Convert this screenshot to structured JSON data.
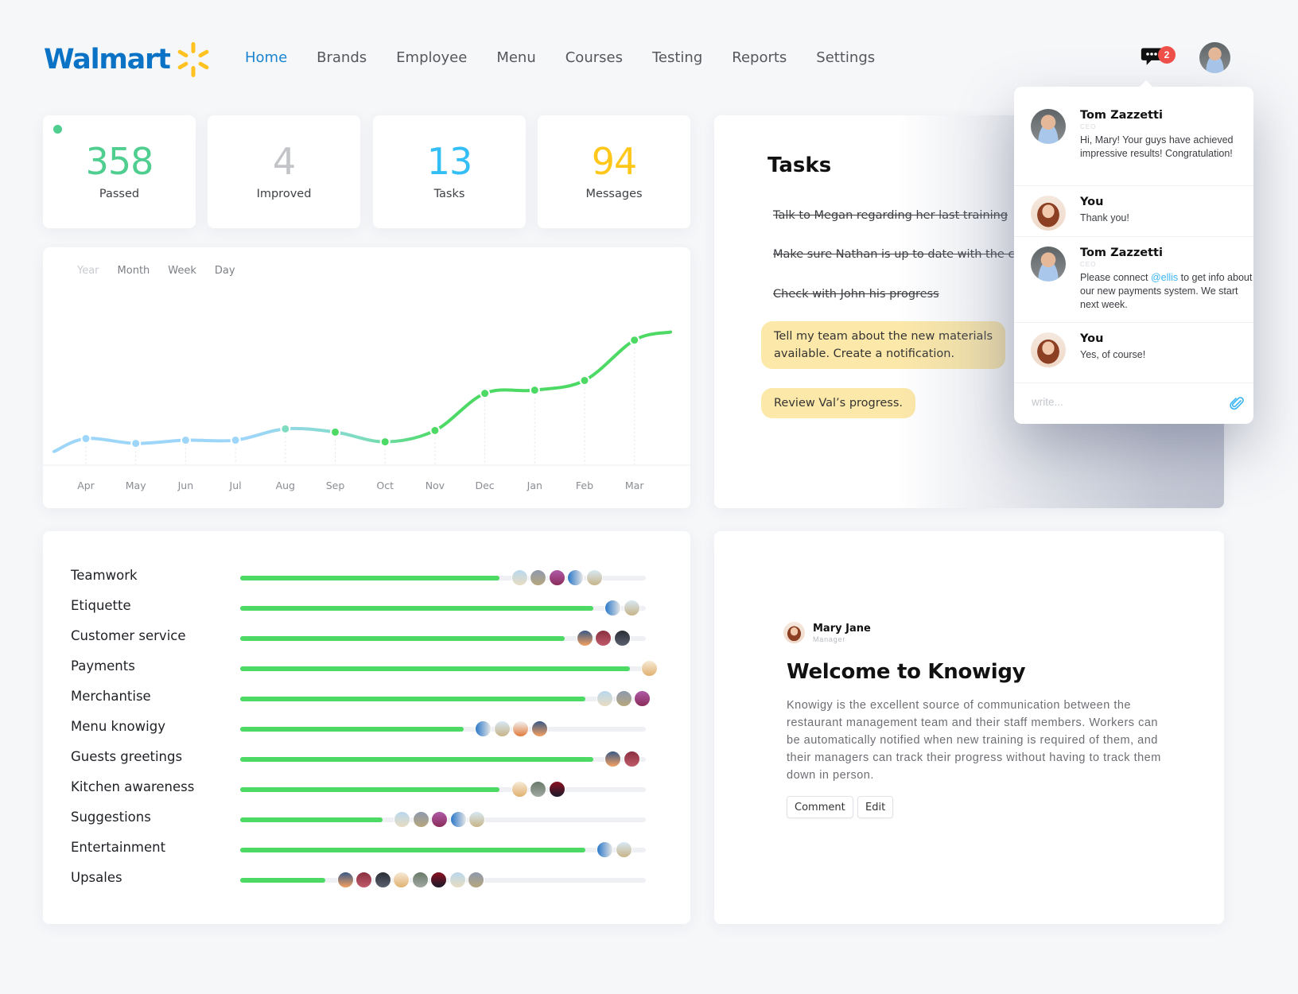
{
  "brand": {
    "name": "Walmart",
    "logo_color": "#0a73c6",
    "spark_color": "#ffc220"
  },
  "nav": {
    "items": [
      {
        "label": "Home",
        "active": true
      },
      {
        "label": "Brands",
        "active": false
      },
      {
        "label": "Employee",
        "active": false
      },
      {
        "label": "Menu",
        "active": false
      },
      {
        "label": "Courses",
        "active": false
      },
      {
        "label": "Testing",
        "active": false
      },
      {
        "label": "Reports",
        "active": false
      },
      {
        "label": "Settings",
        "active": false
      }
    ],
    "chat_icon": "chat-bubble-icon",
    "chat_badge": "2",
    "user_avatar": "avatar"
  },
  "stats": [
    {
      "value": "358",
      "label": "Passed",
      "color": "#4fce8f",
      "online_indicator": true
    },
    {
      "value": "4",
      "label": "Improved",
      "color": "#c3c4c7"
    },
    {
      "value": "13",
      "label": "Tasks",
      "color": "#33bff5"
    },
    {
      "value": "94",
      "label": "Messages",
      "color": "#ffc71a"
    }
  ],
  "chart": {
    "periods": [
      {
        "label": "Year",
        "active": false
      },
      {
        "label": "Month",
        "active": true
      },
      {
        "label": "Week",
        "active": true
      },
      {
        "label": "Day",
        "active": true
      }
    ]
  },
  "chart_data": {
    "type": "line",
    "title": "",
    "xlabel": "",
    "ylabel": "",
    "categories": [
      "Apr",
      "May",
      "Jun",
      "Jul",
      "Aug",
      "Sep",
      "Oct",
      "Nov",
      "Dec",
      "Jan",
      "Feb",
      "Mar"
    ],
    "values": [
      16,
      13,
      15,
      15,
      22,
      20,
      14,
      21,
      44,
      46,
      52,
      77
    ],
    "start_value": 8,
    "end_value": 82,
    "ylim": [
      0,
      100
    ],
    "grid": false,
    "colors": {
      "low": "#9dd6f9",
      "mid": "#7edcc0",
      "high": "#4cd964"
    }
  },
  "tasks": {
    "title": "Tasks",
    "done": [
      "Talk to Megan regarding her last training",
      "Make sure Nathan is up to date with the changes",
      "Check with John his progress"
    ],
    "pending": [
      "Tell my team about the new materials\navailable. Create a notification.",
      "Review Val’s progress."
    ],
    "pending_color": "#fce8a8"
  },
  "chat": {
    "messages": [
      {
        "name": "Tom Zazzetti",
        "role": "CEO",
        "text": "Hi, Mary! Your guys have achieved impressive results! Congratulation!",
        "avatar": "tom"
      },
      {
        "name": "You",
        "role": "",
        "text": "Thank you!",
        "avatar": "mary"
      },
      {
        "name": "Tom Zazzetti",
        "role": "CEO",
        "text_before": "Please connect ",
        "mention": "@ellis",
        "text_after": " to get info about our new payments system. We start next week.",
        "avatar": "tom"
      },
      {
        "name": "You",
        "role": "",
        "text": "Yes, of course!",
        "avatar": "mary"
      }
    ],
    "input_placeholder": "write...",
    "attach_icon": "paperclip-icon"
  },
  "skills": [
    {
      "label": "Teamwork",
      "progress": 0.64,
      "avatars": 5
    },
    {
      "label": "Etiquette",
      "progress": 0.87,
      "avatars": 2
    },
    {
      "label": "Customer service",
      "progress": 0.8,
      "avatars": 3
    },
    {
      "label": "Payments",
      "progress": 0.96,
      "avatars": 1
    },
    {
      "label": "Merchantise",
      "progress": 0.85,
      "avatars": 3
    },
    {
      "label": "Menu knowigy",
      "progress": 0.55,
      "avatars": 4
    },
    {
      "label": "Guests greetings",
      "progress": 0.87,
      "avatars": 2
    },
    {
      "label": "Kitchen awareness",
      "progress": 0.64,
      "avatars": 3
    },
    {
      "label": "Suggestions",
      "progress": 0.35,
      "avatars": 5
    },
    {
      "label": "Entertainment",
      "progress": 0.85,
      "avatars": 2
    },
    {
      "label": "Upsales",
      "progress": 0.21,
      "avatars": 8
    }
  ],
  "welcome": {
    "author_name": "Mary Jane",
    "author_role": "Manager",
    "title": "Welcome to Knowigy",
    "body": "Knowigy is the excellent source of communication between the restaurant management team and their staff members. Workers can be automatically notified when new training is required of them, and their managers can track their progress without having to track them down in person.",
    "comment_label": "Comment",
    "edit_label": "Edit"
  }
}
